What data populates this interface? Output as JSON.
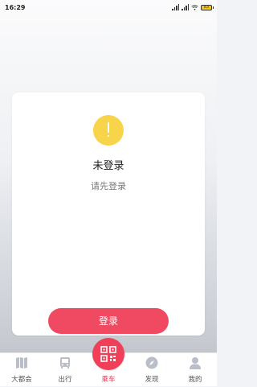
{
  "status_bar": {
    "time": "16:29",
    "battery": "83"
  },
  "card": {
    "title": "未登录",
    "subtitle": "请先登录"
  },
  "login_button": "登录",
  "tabs": [
    {
      "label": "大都会",
      "icon": "map-icon",
      "active": false
    },
    {
      "label": "出行",
      "icon": "bus-icon",
      "active": false
    },
    {
      "label": "乘车",
      "icon": "qr-code-icon",
      "active": true
    },
    {
      "label": "发现",
      "icon": "compass-icon",
      "active": false
    },
    {
      "label": "我的",
      "icon": "person-icon",
      "active": false
    }
  ],
  "colors": {
    "accent": "#ef3f59",
    "warning": "#f8d44a",
    "tab_icon": "#b9bec8"
  }
}
